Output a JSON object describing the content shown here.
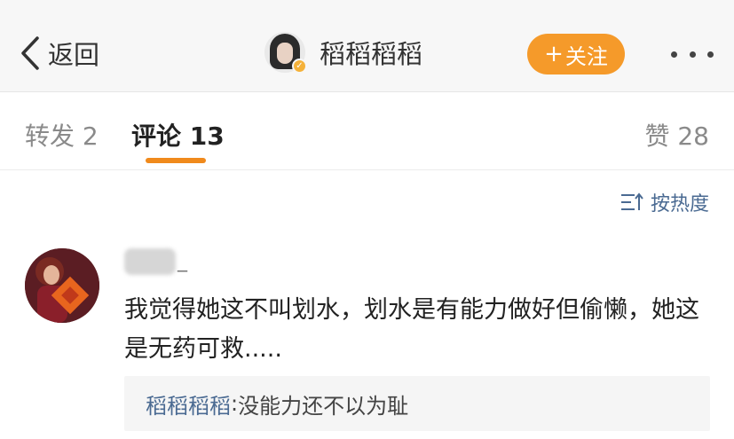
{
  "header": {
    "back_label": "返回",
    "profile_name": "稻稻稻稻",
    "follow_label": "关注",
    "follow_plus": "+",
    "icons": [
      "chevron-left-icon",
      "verified-badge-icon",
      "more-dots-icon"
    ],
    "follow_color": "#f59a2a"
  },
  "tabs": {
    "repost": "转发 2",
    "comments": "评论 13",
    "likes": "赞 28",
    "active_color": "#f08a1c"
  },
  "sort": {
    "label": "按热度",
    "icon": "sort-icon"
  },
  "comment": {
    "username_suffix": "_",
    "text": "我觉得她这不叫划水，划水是有能力做好但偷懒，她这是无药可救.....",
    "reply": {
      "author": "稻稻稻稻",
      "colon": ": ",
      "text": "没能力还不以为耻"
    }
  }
}
